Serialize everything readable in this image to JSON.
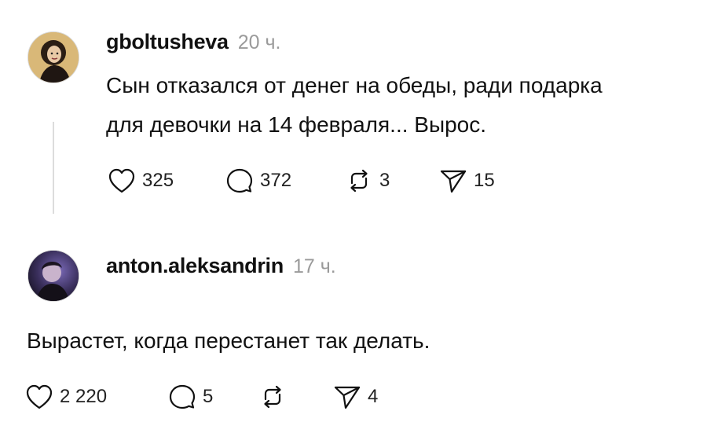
{
  "posts": [
    {
      "username": "gboltusheva",
      "time": "20 ч.",
      "text_lines": [
        "Сын отказался от денег на обеды, ради подарка",
        "для девочки на 14 февраля... Вырос."
      ],
      "likes": "325",
      "replies": "372",
      "reposts": "3",
      "shares": "15",
      "avatar_icon": "avatar-woman-icon"
    },
    {
      "username": "anton.aleksandrin",
      "time": "17 ч.",
      "text": "Вырастет, когда перестанет так делать.",
      "likes": "2 220",
      "replies": "5",
      "reposts": "",
      "shares": "4",
      "avatar_icon": "avatar-man-icon"
    }
  ],
  "icons": {
    "like": "heart-icon",
    "reply": "comment-icon",
    "repost": "repost-icon",
    "share": "send-icon"
  },
  "colors": {
    "text": "#111111",
    "muted": "#9a9a9a",
    "thread_line": "#dcdcdc"
  }
}
